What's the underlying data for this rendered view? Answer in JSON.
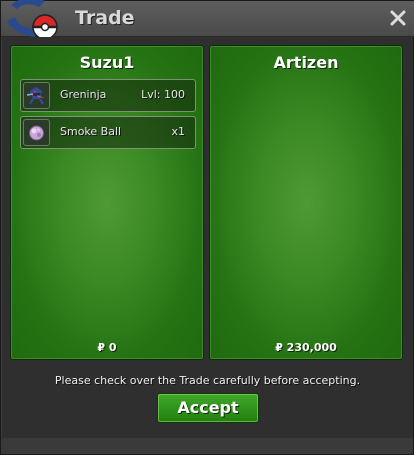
{
  "window": {
    "title": "Trade",
    "close_icon": "close-icon",
    "logo_icon": "pokeball-logo-icon"
  },
  "left_panel": {
    "player_name": "Suzu1",
    "items": [
      {
        "name": "Greninja",
        "meta": "Lvl: 100",
        "icon": "greninja-sprite-icon"
      },
      {
        "name": "Smoke Ball",
        "meta": "x1",
        "icon": "smoke-ball-icon"
      }
    ],
    "money": "₽ 0"
  },
  "right_panel": {
    "player_name": "Artizen",
    "items": [],
    "money": "₽ 230,000"
  },
  "footer": {
    "notice": "Please check over the Trade carefully before accepting.",
    "accept_label": "Accept"
  },
  "colors": {
    "panel_green": "#3c8a25",
    "button_green": "#23800f",
    "window_bg": "#2f2f2f"
  }
}
